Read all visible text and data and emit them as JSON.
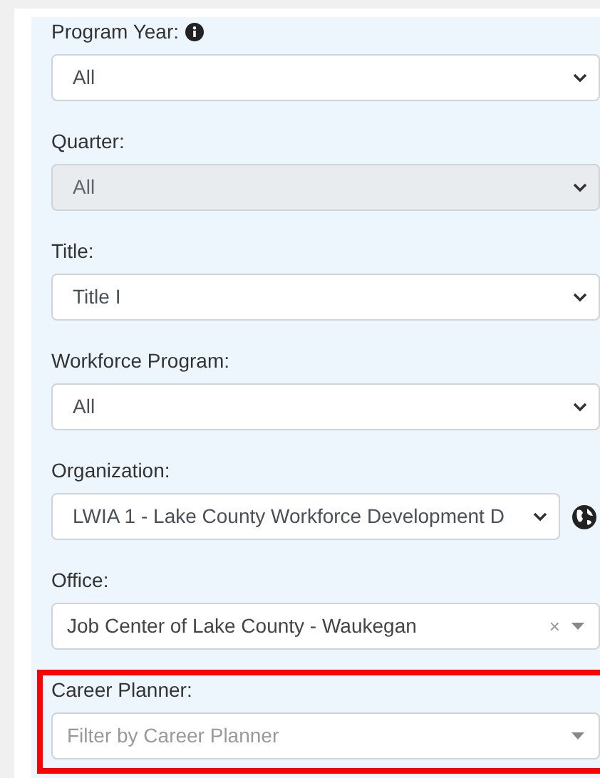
{
  "filters": [
    {
      "label": "Program Year:",
      "info_icon": true,
      "kind": "select",
      "value": "All",
      "disabled": false,
      "highlighted": false
    },
    {
      "label": "Quarter:",
      "info_icon": false,
      "kind": "select",
      "value": "All",
      "disabled": true,
      "highlighted": false
    },
    {
      "label": "Title:",
      "info_icon": false,
      "kind": "select",
      "value": "Title I",
      "disabled": false,
      "highlighted": false
    },
    {
      "label": "Workforce Program:",
      "info_icon": false,
      "kind": "select",
      "value": "All",
      "disabled": false,
      "highlighted": false
    },
    {
      "label": "Organization:",
      "info_icon": false,
      "kind": "select_globe",
      "value": "LWIA 1 - Lake County Workforce Development D",
      "disabled": false,
      "highlighted": false
    },
    {
      "label": "Office:",
      "info_icon": false,
      "kind": "combo",
      "value": "Job Center of Lake County - Waukegan",
      "clear": "×",
      "disabled": false,
      "highlighted": false
    },
    {
      "label": "Career Planner:",
      "info_icon": false,
      "kind": "combo",
      "placeholder": "Filter by Career Planner",
      "disabled": false,
      "highlighted": true
    }
  ]
}
